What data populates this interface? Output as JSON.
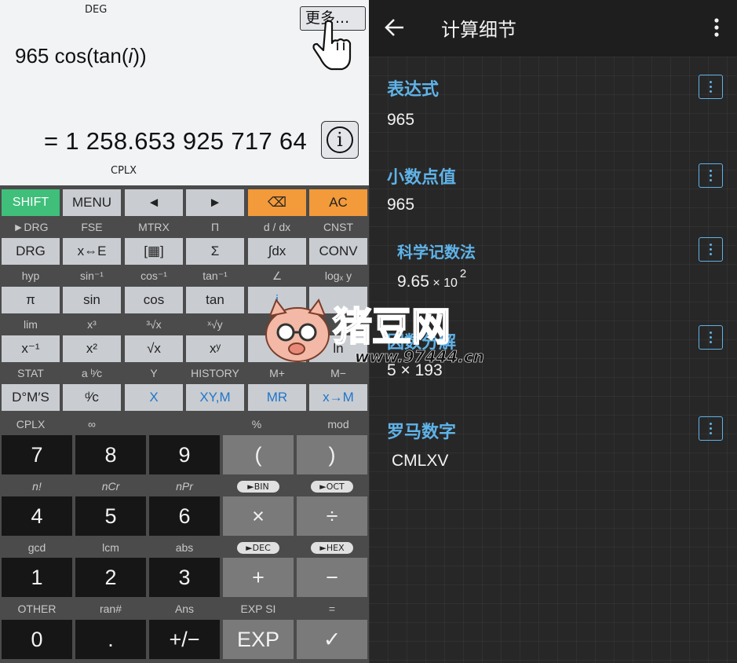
{
  "display": {
    "mode": "DEG",
    "expression_prefix": "965 cos(tan(",
    "expression_var": "i",
    "expression_suffix": "))",
    "result": "= 1 258.653 925 717 64",
    "complex_indicator": "CPLX",
    "more_button": "更多...",
    "info_glyph": "i"
  },
  "keys": {
    "row1": [
      "SHIFT",
      "MENU",
      "◄",
      "►",
      "⌫",
      "AC"
    ],
    "row1_sub": [
      "►DRG",
      "FSE",
      "MTRX",
      "Π",
      "d / dx",
      "CNST"
    ],
    "row2": [
      "DRG",
      "x⇔E",
      "[▦]",
      "Σ",
      "∫dx",
      "CONV"
    ],
    "row2_sub": [
      "hyp",
      "sin⁻¹",
      "cos⁻¹",
      "tan⁻¹",
      "∠",
      "logₓ y"
    ],
    "row3": [
      "π",
      "sin",
      "cos",
      "tan",
      "i",
      ""
    ],
    "row3_sub": [
      "lim",
      "x³",
      "³√x",
      "ˣ√y",
      "",
      ""
    ],
    "row4": [
      "x⁻¹",
      "x²",
      "√x",
      "xʸ",
      "",
      "ln"
    ],
    "row4_sub": [
      "STAT",
      "a ᵇ⁄c",
      "Y",
      "HISTORY",
      "M+",
      "M−"
    ],
    "row5": [
      "D°M′S",
      "ᵈ⁄c",
      "X",
      "XY,M",
      "MR",
      "x→M"
    ],
    "row5_sub": [
      "CPLX",
      "∞",
      "",
      "%",
      "mod"
    ],
    "num1": [
      "7",
      "8",
      "9",
      "(",
      ")"
    ],
    "num1_sub": [
      "n!",
      "nCr",
      "nPr",
      "►BIN",
      "►OCT"
    ],
    "num2": [
      "4",
      "5",
      "6",
      "×",
      "÷"
    ],
    "num2_sub": [
      "gcd",
      "lcm",
      "abs",
      "►DEC",
      "►HEX"
    ],
    "num3": [
      "1",
      "2",
      "3",
      "+",
      "−"
    ],
    "num3_sub": [
      "OTHER",
      "ran#",
      "Ans",
      "EXP SI",
      "="
    ],
    "num4": [
      "0",
      ".",
      "+/−",
      "EXP",
      "✓"
    ]
  },
  "details": {
    "title": "计算细节",
    "sections": [
      {
        "title": "表达式",
        "value": "965"
      },
      {
        "title": "小数点值",
        "value": "965"
      },
      {
        "title": "科学记数法",
        "value_mantissa": "9.65",
        "value_times": "×",
        "value_base": "10",
        "value_exp": "2"
      },
      {
        "title": "因数分解",
        "value": "5 × 193"
      },
      {
        "title": "罗马数字",
        "value": "CMLXV"
      }
    ]
  },
  "watermark": {
    "brand": "猪豆网",
    "url": "www.97444.cn"
  },
  "colors": {
    "shift": "#3fbf7a",
    "orange": "#f39a3a",
    "accent_blue": "#5fb3e8",
    "key_blue_text": "#1f77c9"
  }
}
